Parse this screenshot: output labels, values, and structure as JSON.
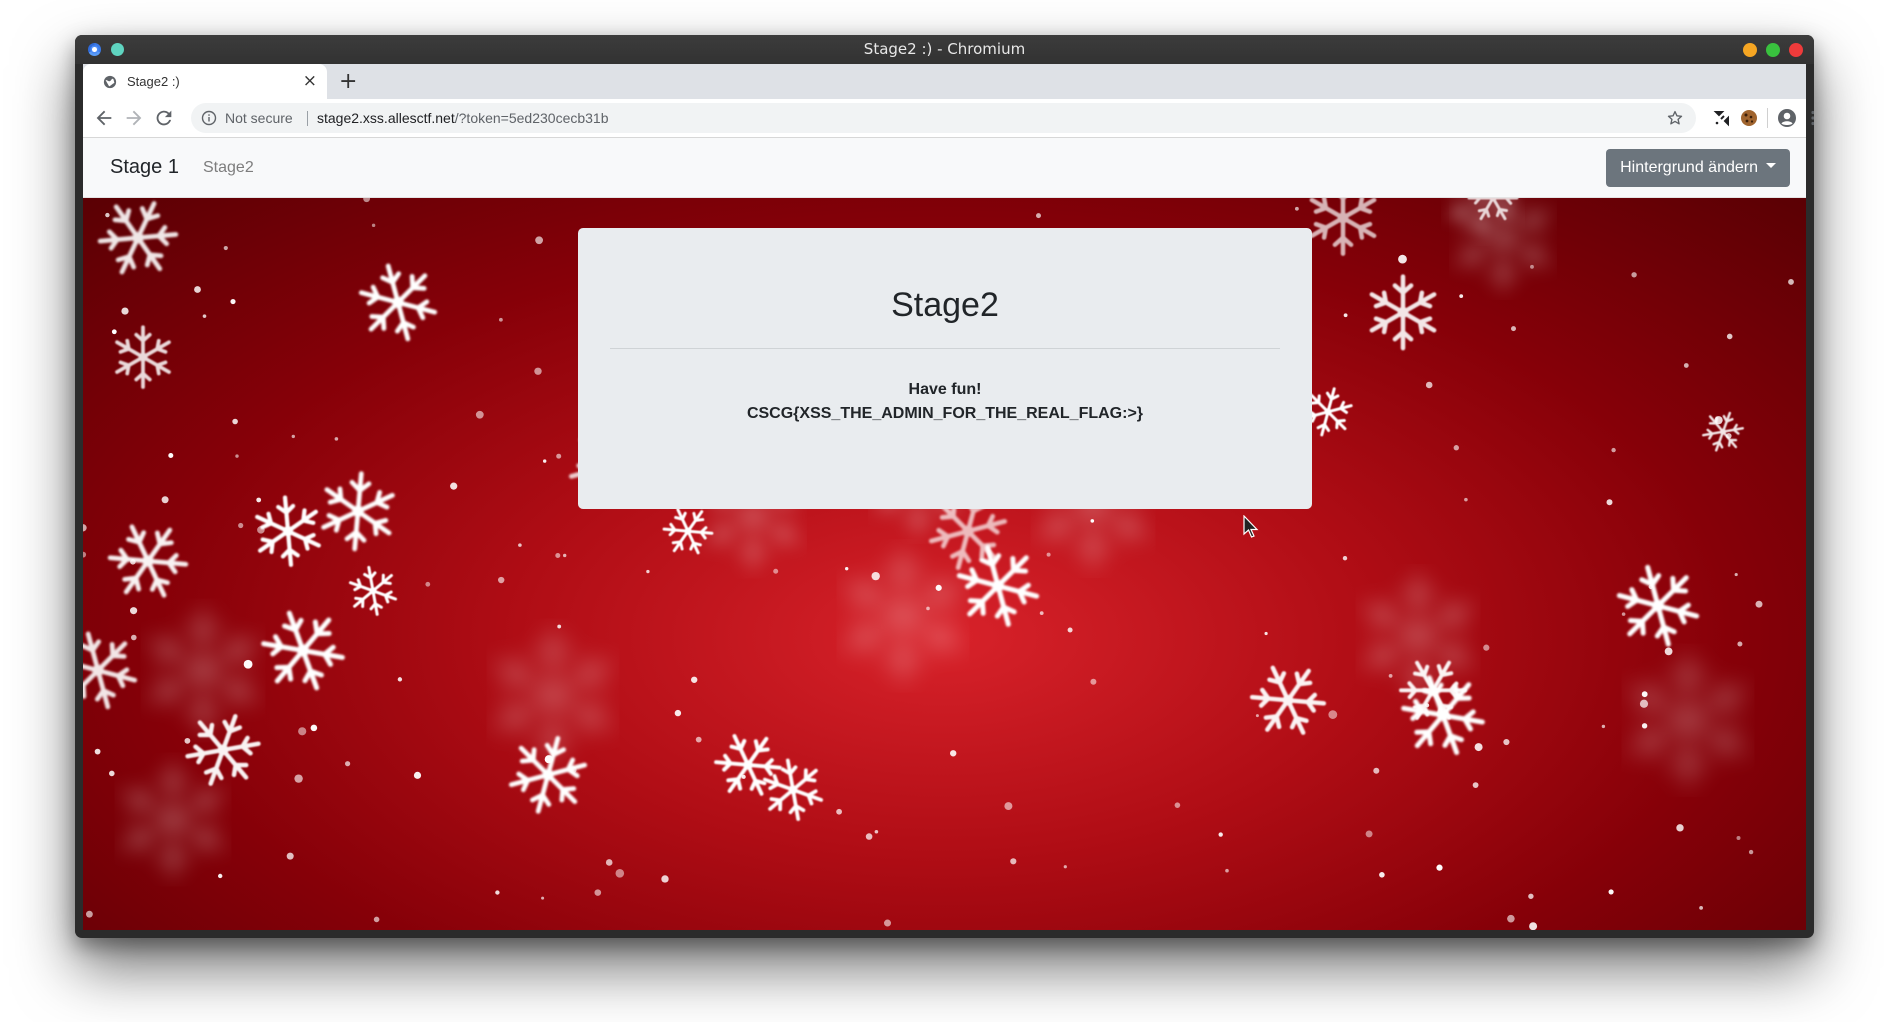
{
  "window": {
    "title": "Stage2 :) - Chromium"
  },
  "tab": {
    "title": "Stage2 :)",
    "close_glyph": "×",
    "new_tab_glyph": "+"
  },
  "omnibox": {
    "security_label": "Not secure",
    "url_host": "stage2.xss.allesctf.net",
    "url_path": "/?token=5ed230cecb31b"
  },
  "navbar": {
    "brand": "Stage 1",
    "link": "Stage2",
    "dropdown_label": "Hintergrund ändern"
  },
  "jumbotron": {
    "heading": "Stage2",
    "line1": "Have fun!",
    "line2": "CSCG{XSS_THE_ADMIN_FOR_THE_REAL_FLAG:>}"
  },
  "colors": {
    "background_red": "#b00d15",
    "navbar_bg": "#f8f9fa",
    "dropdown_bg": "#6c757d",
    "jumbotron_bg": "#e9ecef"
  },
  "icons": [
    "chromium-icon",
    "back-arrow-icon",
    "forward-arrow-icon",
    "reload-icon",
    "info-icon",
    "star-icon",
    "extension-icon",
    "cookie-icon",
    "account-icon",
    "menu-kebab-icon",
    "snowflake-icon",
    "mouse-cursor-icon"
  ]
}
